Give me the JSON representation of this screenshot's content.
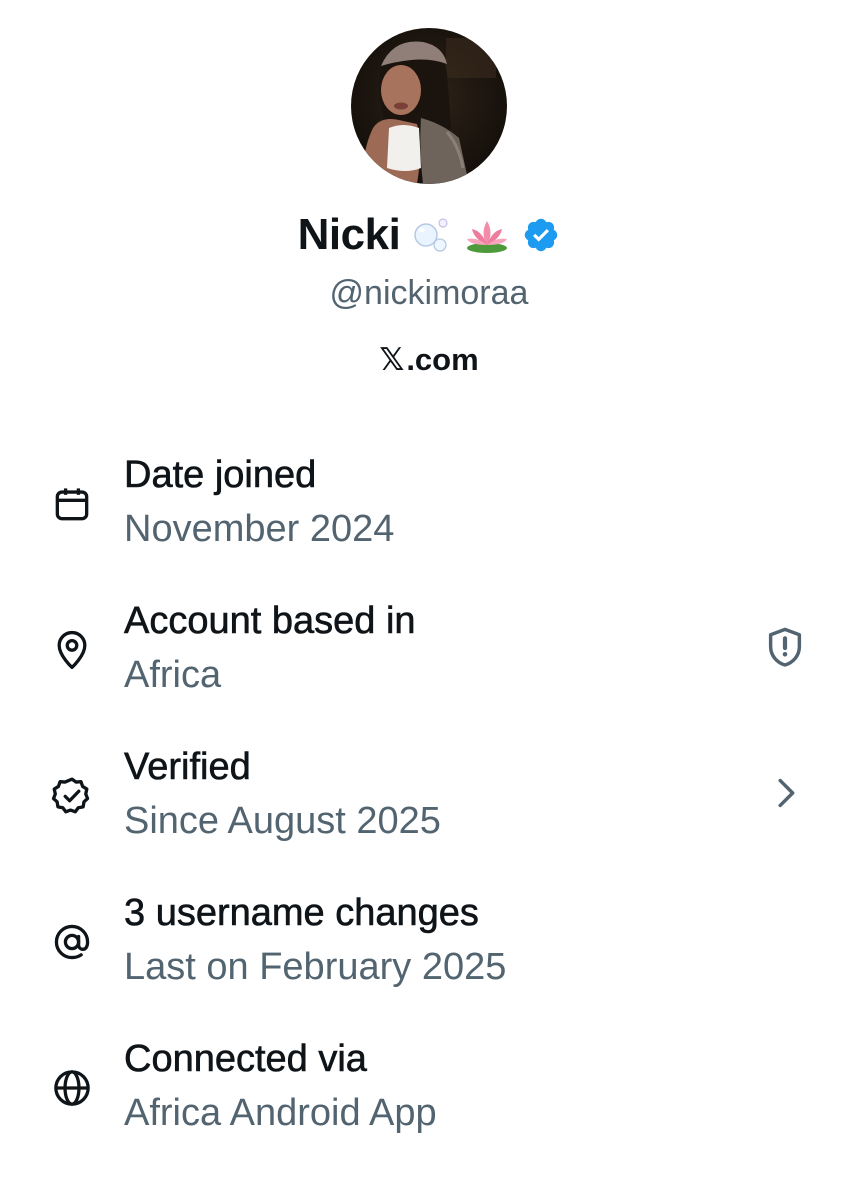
{
  "profile": {
    "display_name": "Nicki",
    "name_emojis": [
      "bubbles-emoji",
      "lotus-emoji"
    ],
    "verified_badge": "blue-check-badge",
    "handle": "@nickimoraa",
    "site_mark": "𝕏",
    "site_suffix": ".com"
  },
  "info": [
    {
      "icon": "calendar-icon",
      "title": "Date joined",
      "subtitle": "November 2024"
    },
    {
      "icon": "location-pin-icon",
      "title": "Account based in",
      "subtitle": "Africa",
      "trailing_icon": "shield-alert-icon"
    },
    {
      "icon": "verified-badge-icon",
      "title": "Verified",
      "subtitle": "Since August 2025",
      "trailing_icon": "chevron-right-icon"
    },
    {
      "icon": "at-sign-icon",
      "title": "3 username changes",
      "subtitle": "Last on February 2025"
    },
    {
      "icon": "globe-icon",
      "title": "Connected via",
      "subtitle": "Africa Android App"
    }
  ],
  "colors": {
    "primary_text": "#0f1419",
    "secondary_text": "#536471",
    "verified_blue": "#1d9bf0",
    "background": "#ffffff"
  }
}
